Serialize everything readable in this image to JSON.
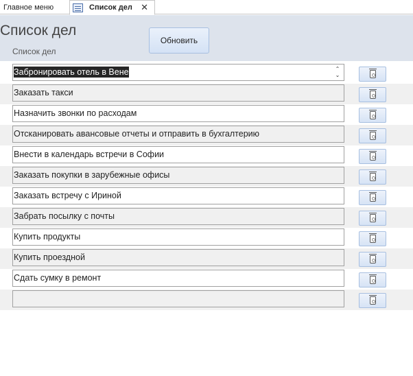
{
  "tabs": {
    "main_menu": "Главное меню",
    "active": "Список дел",
    "close_glyph": "✕"
  },
  "header": {
    "title": "Список дел",
    "column_label": "Список дел",
    "refresh_label": "Обновить"
  },
  "tasks": [
    {
      "text": "Забронировать отель в Вене",
      "selected": true
    },
    {
      "text": "Заказать такси"
    },
    {
      "text": "Назначить звонки по расходам"
    },
    {
      "text": "Отсканировать авансовые отчеты и отправить в бухгалтерию"
    },
    {
      "text": "Внести в календарь встречи в Софии"
    },
    {
      "text": "Заказать покупки в зарубежные офисы"
    },
    {
      "text": "Заказать встречу с Ириной"
    },
    {
      "text": "Забрать посылку с почты"
    },
    {
      "text": "Купить продукты"
    },
    {
      "text": "Купить проездной"
    },
    {
      "text": "Сдать сумку в ремонт"
    },
    {
      "text": ""
    }
  ],
  "icons": {
    "tab_icon": "form-icon",
    "delete_icon": "trash-icon"
  }
}
